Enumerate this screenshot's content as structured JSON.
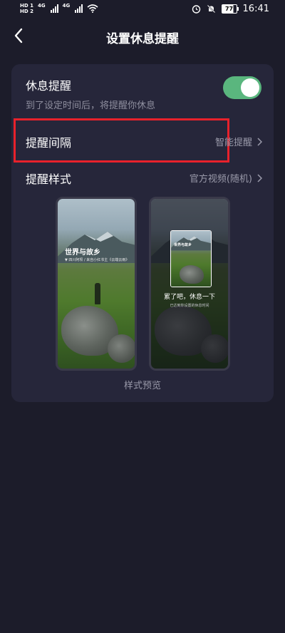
{
  "status_bar": {
    "hd1": "HD 1",
    "hd2": "HD 2",
    "net1": "4G",
    "net2": "4G",
    "battery": "77",
    "time": "16:41"
  },
  "header": {
    "title": "设置休息提醒"
  },
  "settings": {
    "rest_reminder": {
      "label": "休息提醒",
      "description": "到了设定时间后，将提醒你休息",
      "enabled": true
    },
    "interval": {
      "label": "提醒间隔",
      "value": "智能提醒"
    },
    "style": {
      "label": "提醒样式",
      "value": "官方视频(随机)"
    }
  },
  "preview": {
    "left": {
      "title": "世界与故乡",
      "caption": "▼ 四川阿坝 / 来自小红书主《云端云雨》"
    },
    "right": {
      "mini_title": "世界与故乡",
      "rest_text": "累了吧，休息一下",
      "rest_sub": "已达到你设置的休息时间"
    },
    "label": "样式预览"
  },
  "colors": {
    "background": "#1c1c2a",
    "card": "#26263a",
    "toggle_on": "#5ab67e",
    "highlight": "#e8212b"
  },
  "icons": {
    "back": "chevron-left-icon",
    "chevron": "chevron-right-icon",
    "alarm": "alarm-icon",
    "mute": "bell-off-icon",
    "wifi": "wifi-icon"
  }
}
